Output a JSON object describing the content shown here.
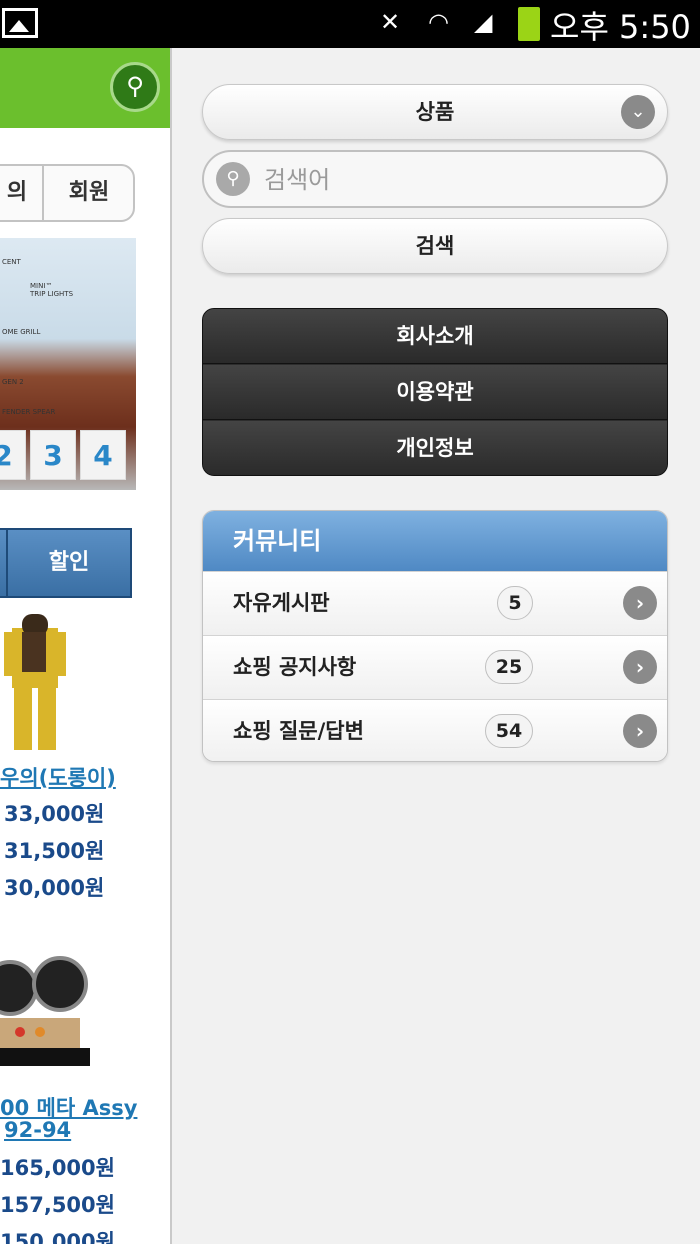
{
  "status_bar": {
    "time": "오후 5:50",
    "icons": [
      "gallery-icon",
      "mute-vibrate-icon",
      "wifi-icon",
      "signal-icon",
      "battery-icon"
    ]
  },
  "background_page": {
    "tabs": [
      "의",
      "회원"
    ],
    "pager": [
      "2",
      "3",
      "4"
    ],
    "button": "할인",
    "products": [
      {
        "name": "우의(도롱이)",
        "prices": [
          "33,000원",
          "31,500원",
          "30,000원"
        ]
      },
      {
        "name_line1": "00 메타 Assy",
        "name_line2": "92-94",
        "prices": [
          "165,000원",
          "157,500원",
          "150,000원"
        ]
      }
    ],
    "banner_text": [
      "CENT",
      "MINI™",
      "TRIP LIGHTS",
      "OME GRILL",
      "GEN 2",
      "FENDER SPEAR"
    ]
  },
  "panel": {
    "category_select": {
      "value": "상품"
    },
    "search": {
      "placeholder": "검색어",
      "button_label": "검색"
    },
    "menu": [
      {
        "label": "회사소개"
      },
      {
        "label": "이용약관"
      },
      {
        "label": "개인정보"
      }
    ],
    "community": {
      "title": "커뮤니티",
      "items": [
        {
          "label": "자유게시판",
          "count": "5"
        },
        {
          "label": "쇼핑 공지사항",
          "count": "25"
        },
        {
          "label": "쇼핑 질문/답변",
          "count": "54"
        }
      ]
    }
  },
  "colors": {
    "header_green": "#6bbf2d",
    "community_blue": "#5a93cc",
    "dark_menu": "#2d2d2d",
    "link_blue": "#1f78b4"
  }
}
